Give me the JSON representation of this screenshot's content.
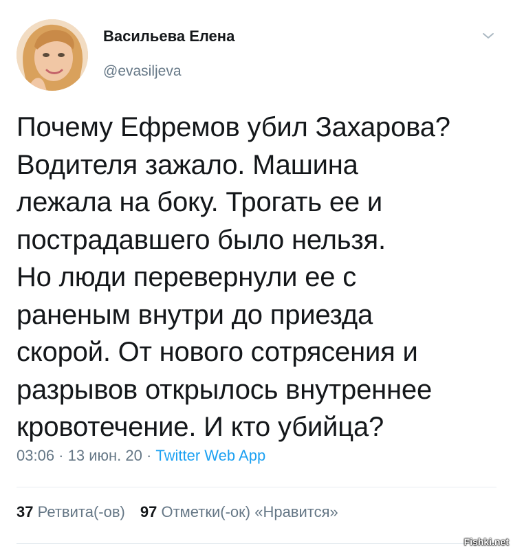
{
  "author": {
    "display_name": "Васильева Елена",
    "handle": "@evasiljeva",
    "avatar_icon": "user-avatar"
  },
  "menu": {
    "icon": "chevron-down-icon"
  },
  "tweet": {
    "text": "Почему Ефремов убил Захарова?\nВодителя зажало. Машина\nлежала на боку. Трогать ее и\nпострадавшего было нельзя.\nНо люди перевернули ее с\nраненым внутри до приезда\nскорой. От нового сотрясения и\nразрывов открылось внутреннее\nкровотечение. И кто убийца?",
    "time": "03:06",
    "date": "13 июн. 20",
    "separator": " · ",
    "source": "Twitter Web App"
  },
  "stats": {
    "retweets_count": "37",
    "retweets_label": "Ретвита(-ов)",
    "likes_count": "97",
    "likes_label": "Отметки(-ок) «Нравится»"
  },
  "watermark": "Fishki.net",
  "colors": {
    "text": "#14171a",
    "muted": "#657786",
    "link": "#1da1f2",
    "divider": "#e6ecf0"
  }
}
